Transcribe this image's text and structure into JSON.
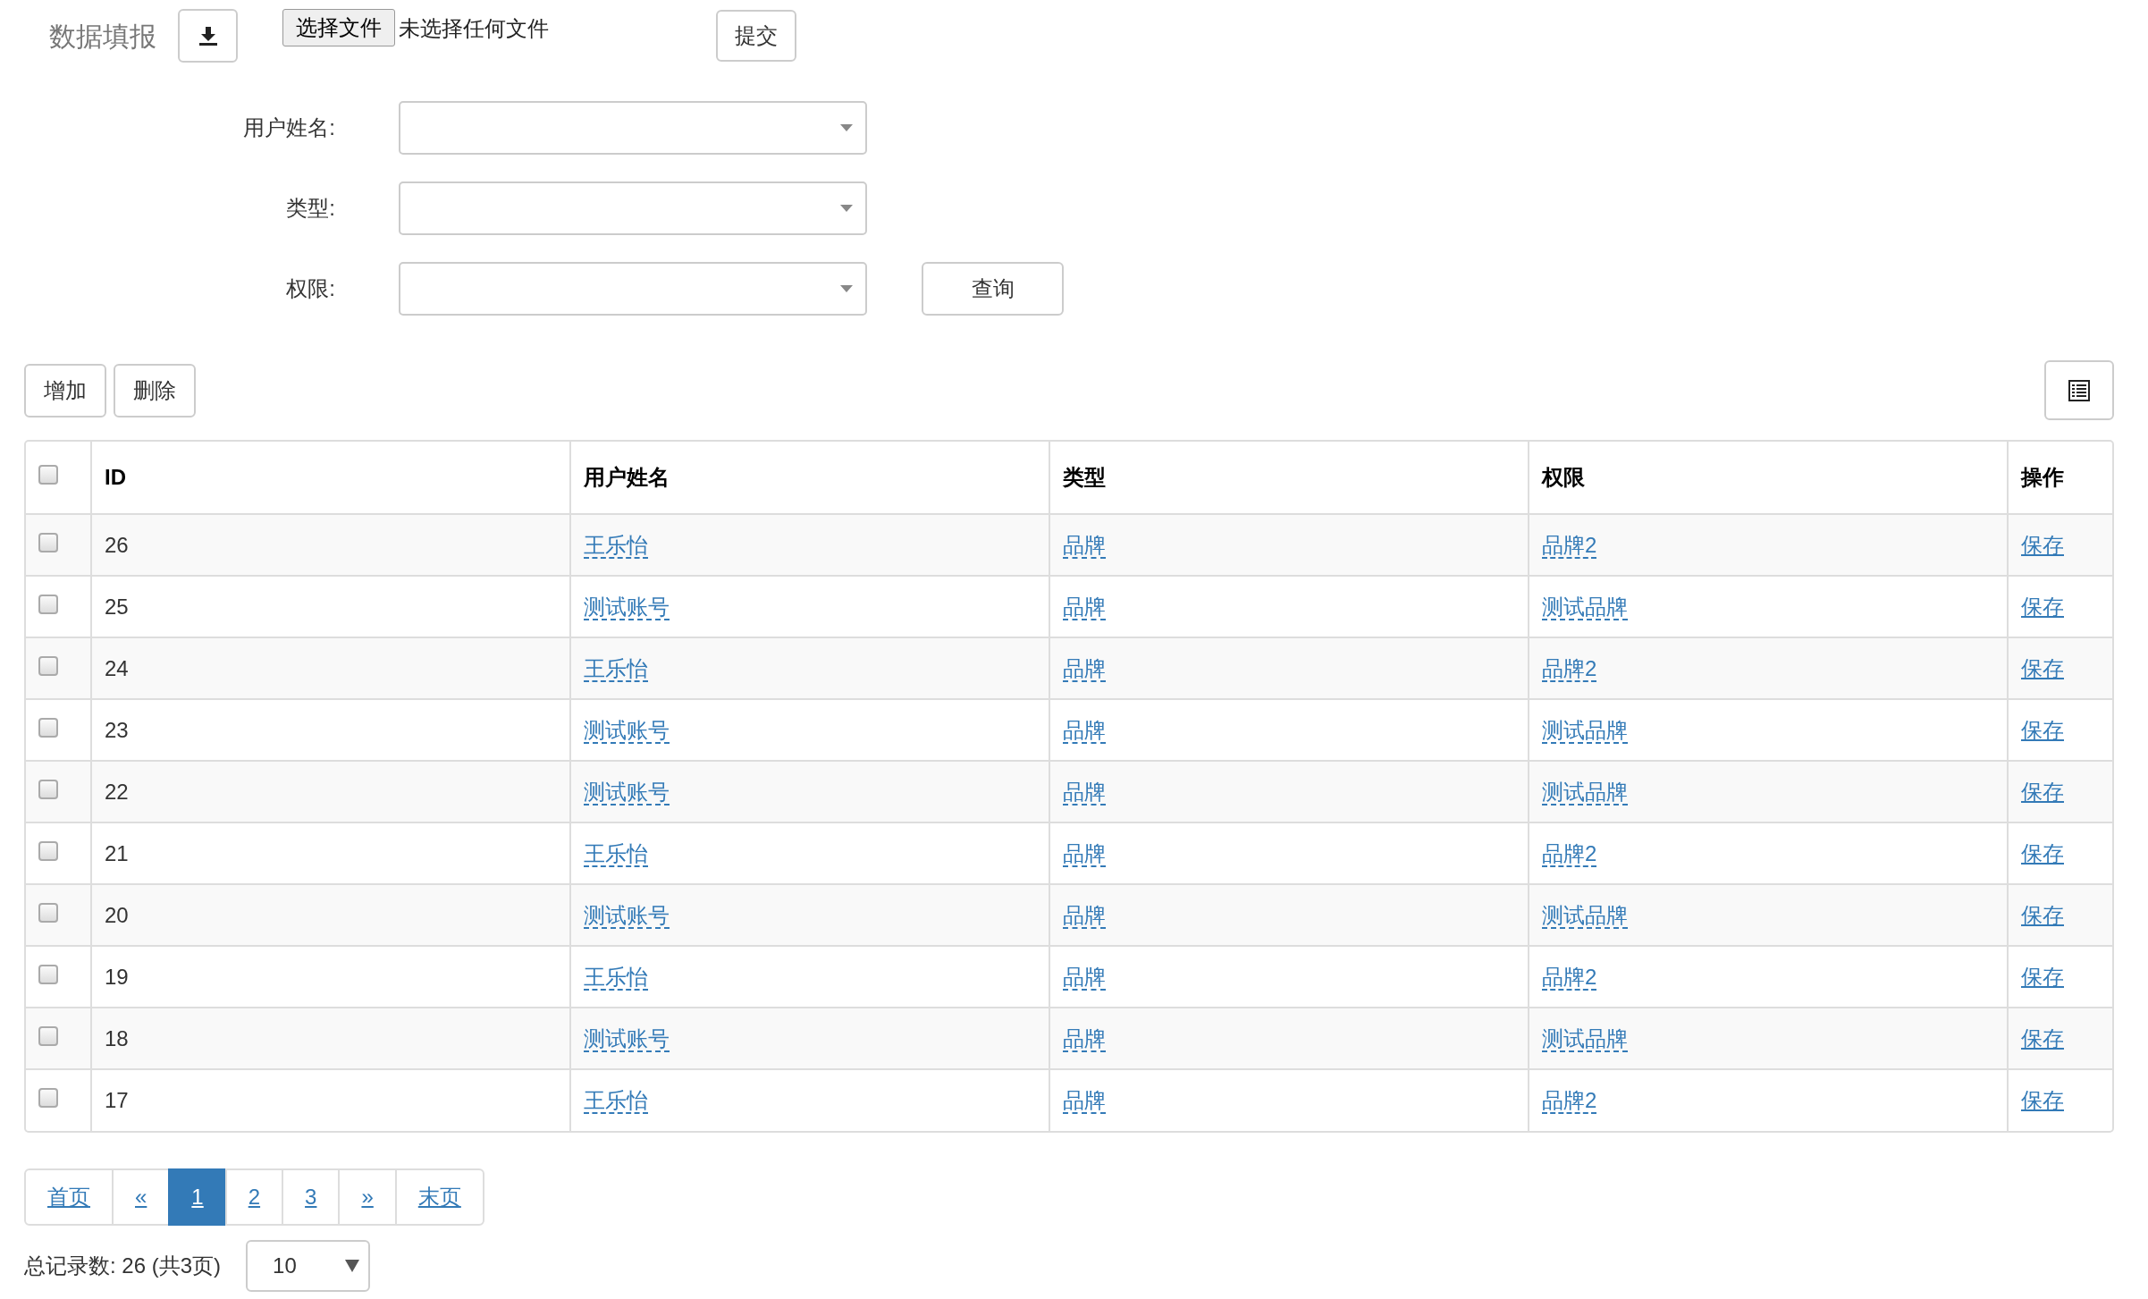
{
  "header": {
    "title": "数据填报",
    "file_button": "选择文件",
    "file_status": "未选择任何文件",
    "submit_button": "提交"
  },
  "filters": [
    {
      "label": "用户姓名:"
    },
    {
      "label": "类型:"
    },
    {
      "label": "权限:"
    }
  ],
  "query_button": "查询",
  "toolbar": [
    "增加",
    "删除"
  ],
  "table": {
    "header_checked": false,
    "columns": [
      "ID",
      "用户姓名",
      "类型",
      "权限",
      "操作"
    ],
    "rows": [
      {
        "checked": false,
        "id": "26",
        "name": "王乐怡",
        "type": "品牌",
        "permission": "品牌2",
        "action": "保存"
      },
      {
        "checked": false,
        "id": "25",
        "name": "测试账号",
        "type": "品牌",
        "permission": "测试品牌",
        "action": "保存"
      },
      {
        "checked": false,
        "id": "24",
        "name": "王乐怡",
        "type": "品牌",
        "permission": "品牌2",
        "action": "保存"
      },
      {
        "checked": false,
        "id": "23",
        "name": "测试账号",
        "type": "品牌",
        "permission": "测试品牌",
        "action": "保存"
      },
      {
        "checked": false,
        "id": "22",
        "name": "测试账号",
        "type": "品牌",
        "permission": "测试品牌",
        "action": "保存"
      },
      {
        "checked": false,
        "id": "21",
        "name": "王乐怡",
        "type": "品牌",
        "permission": "品牌2",
        "action": "保存"
      },
      {
        "checked": false,
        "id": "20",
        "name": "测试账号",
        "type": "品牌",
        "permission": "测试品牌",
        "action": "保存"
      },
      {
        "checked": false,
        "id": "19",
        "name": "王乐怡",
        "type": "品牌",
        "permission": "品牌2",
        "action": "保存"
      },
      {
        "checked": false,
        "id": "18",
        "name": "测试账号",
        "type": "品牌",
        "permission": "测试品牌",
        "action": "保存"
      },
      {
        "checked": false,
        "id": "17",
        "name": "王乐怡",
        "type": "品牌",
        "permission": "品牌2",
        "action": "保存"
      }
    ]
  },
  "pagination": [
    {
      "label": "首页",
      "selected": false
    },
    {
      "label": "«",
      "selected": false
    },
    {
      "label": "1",
      "selected": true
    },
    {
      "label": "2",
      "selected": false
    },
    {
      "label": "3",
      "selected": false
    },
    {
      "label": "»",
      "selected": false
    },
    {
      "label": "末页",
      "selected": false
    }
  ],
  "summary": "总记录数: 26 (共3页)",
  "page_size": "10"
}
